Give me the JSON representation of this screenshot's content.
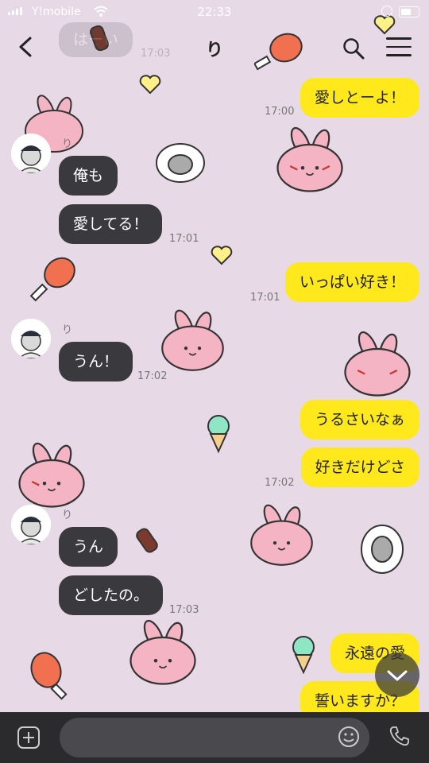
{
  "status": {
    "carrier": "Y!mobile",
    "time": "22:33"
  },
  "header": {
    "title": "り"
  },
  "messages": [
    {
      "id": "m1",
      "dir": "sent",
      "text": "愛しとーよ！",
      "time": "17:00"
    },
    {
      "id": "m2",
      "dir": "recv",
      "sender": "り",
      "text": "俺も",
      "time": ""
    },
    {
      "id": "m3",
      "dir": "recv",
      "text": "愛してる！",
      "time": "17:01"
    },
    {
      "id": "m4",
      "dir": "sent",
      "text": "いっぱい好き！",
      "time": "17:01"
    },
    {
      "id": "m5",
      "dir": "recv",
      "sender": "り",
      "text": "うん！",
      "time": "17:02"
    },
    {
      "id": "m6",
      "dir": "sent",
      "text": "うるさいなぁ",
      "time": ""
    },
    {
      "id": "m7",
      "dir": "sent",
      "text": "好きだけどさ",
      "time": "17:02"
    },
    {
      "id": "m8",
      "dir": "recv",
      "sender": "り",
      "text": "うん",
      "time": ""
    },
    {
      "id": "m9",
      "dir": "recv",
      "text": "どしたの。",
      "time": "17:03"
    },
    {
      "id": "m10",
      "dir": "sent",
      "text": "永遠の愛",
      "time": ""
    },
    {
      "id": "m11",
      "dir": "sent",
      "text": "誓いますか？",
      "time": ""
    }
  ],
  "top_partial": {
    "text": "はーい",
    "time": "17:03"
  },
  "input": {
    "placeholder": ""
  },
  "colors": {
    "background": "#e7d9e6",
    "sent_bubble": "#ffe81c",
    "recv_bubble": "#3a3a3e"
  }
}
